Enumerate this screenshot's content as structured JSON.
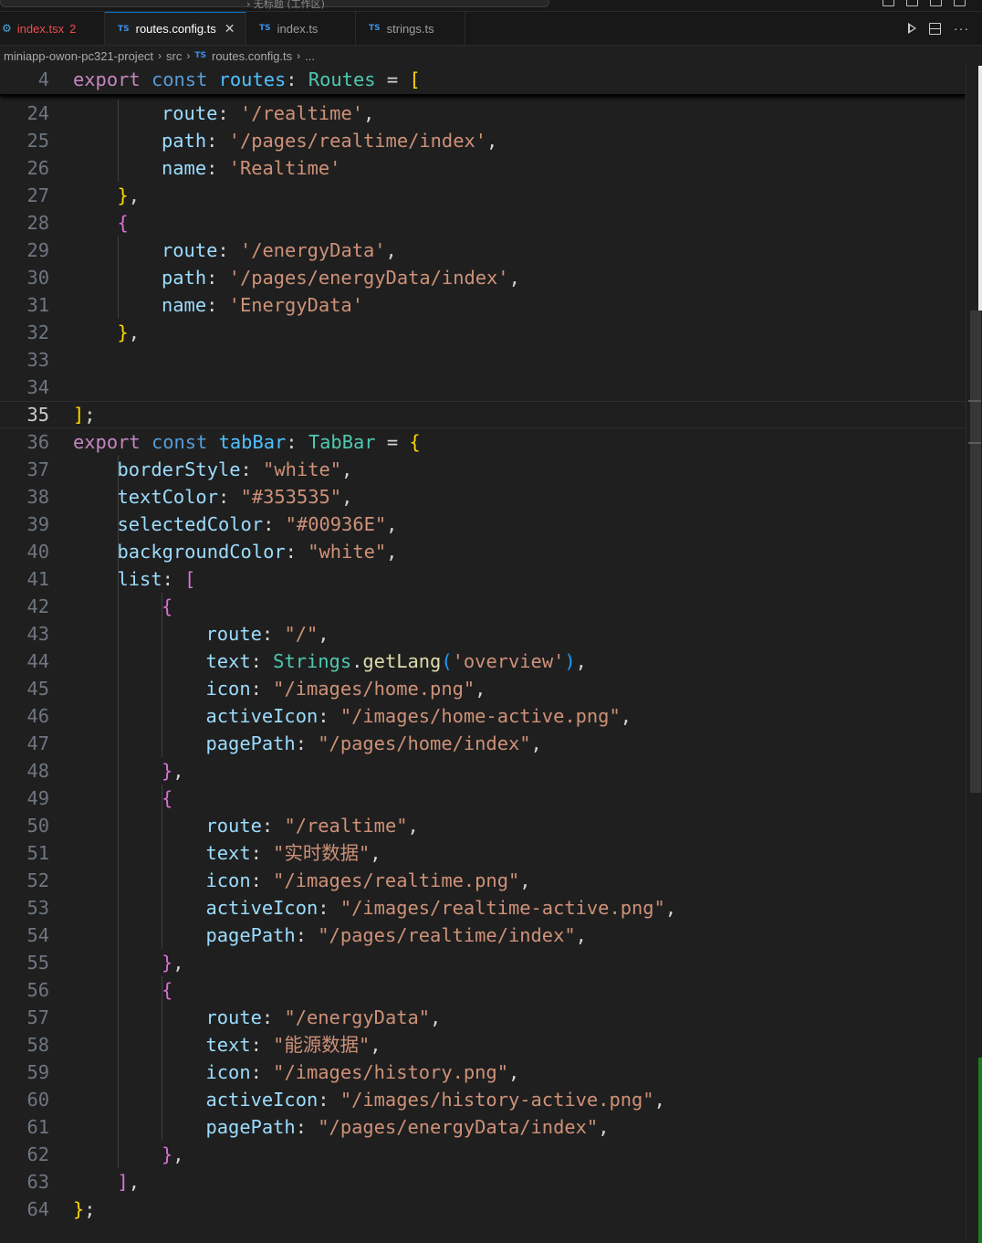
{
  "titlebar": {
    "text": "› 无标题 (工作区)"
  },
  "tabs": [
    {
      "label": "index.tsx",
      "badge": "2",
      "kind": "react"
    },
    {
      "label": "routes.config.ts",
      "kind": "ts",
      "active": true
    },
    {
      "label": "index.ts",
      "kind": "ts"
    },
    {
      "label": "strings.ts",
      "kind": "ts"
    }
  ],
  "breadcrumb": [
    "miniapp-owon-pc321-project",
    "src",
    "routes.config.ts",
    "..."
  ],
  "editor": {
    "current_line": 35,
    "sticky_line": {
      "number": "4",
      "text": "export const routes: Routes = ["
    },
    "lines": [
      {
        "n": "24",
        "text": "route: '/realtime',",
        "indent": 2
      },
      {
        "n": "25",
        "text": "path: '/pages/realtime/index',",
        "indent": 2
      },
      {
        "n": "26",
        "text": "name: 'Realtime'",
        "indent": 2
      },
      {
        "n": "27",
        "text": "},",
        "indent": 1
      },
      {
        "n": "28",
        "text": "{",
        "indent": 1
      },
      {
        "n": "29",
        "text": "route: '/energyData',",
        "indent": 2
      },
      {
        "n": "30",
        "text": "path: '/pages/energyData/index',",
        "indent": 2
      },
      {
        "n": "31",
        "text": "name: 'EnergyData'",
        "indent": 2
      },
      {
        "n": "32",
        "text": "},",
        "indent": 1
      },
      {
        "n": "33",
        "text": "",
        "indent": 0
      },
      {
        "n": "34",
        "text": "",
        "indent": 0
      },
      {
        "n": "35",
        "text": "];",
        "indent": 0
      },
      {
        "n": "36",
        "text": "export const tabBar: TabBar = {",
        "indent": 0
      },
      {
        "n": "37",
        "text": "borderStyle: \"white\",",
        "indent": 1
      },
      {
        "n": "38",
        "text": "textColor: \"#353535\",",
        "indent": 1
      },
      {
        "n": "39",
        "text": "selectedColor: \"#00936E\",",
        "indent": 1
      },
      {
        "n": "40",
        "text": "backgroundColor: \"white\",",
        "indent": 1
      },
      {
        "n": "41",
        "text": "list: [",
        "indent": 1
      },
      {
        "n": "42",
        "text": "{",
        "indent": 2
      },
      {
        "n": "43",
        "text": "route: \"/\",",
        "indent": 3
      },
      {
        "n": "44",
        "text": "text: Strings.getLang('overview'),",
        "indent": 3
      },
      {
        "n": "45",
        "text": "icon: \"/images/home.png\",",
        "indent": 3
      },
      {
        "n": "46",
        "text": "activeIcon: \"/images/home-active.png\",",
        "indent": 3
      },
      {
        "n": "47",
        "text": "pagePath: \"/pages/home/index\",",
        "indent": 3
      },
      {
        "n": "48",
        "text": "},",
        "indent": 2
      },
      {
        "n": "49",
        "text": "{",
        "indent": 2
      },
      {
        "n": "50",
        "text": "route: \"/realtime\",",
        "indent": 3
      },
      {
        "n": "51",
        "text": "text: \"实时数据\",",
        "indent": 3
      },
      {
        "n": "52",
        "text": "icon: \"/images/realtime.png\",",
        "indent": 3
      },
      {
        "n": "53",
        "text": "activeIcon: \"/images/realtime-active.png\",",
        "indent": 3
      },
      {
        "n": "54",
        "text": "pagePath: \"/pages/realtime/index\",",
        "indent": 3
      },
      {
        "n": "55",
        "text": "},",
        "indent": 2
      },
      {
        "n": "56",
        "text": "{",
        "indent": 2
      },
      {
        "n": "57",
        "text": "route: \"/energyData\",",
        "indent": 3
      },
      {
        "n": "58",
        "text": "text: \"能源数据\",",
        "indent": 3
      },
      {
        "n": "59",
        "text": "icon: \"/images/history.png\",",
        "indent": 3
      },
      {
        "n": "60",
        "text": "activeIcon: \"/images/history-active.png\",",
        "indent": 3
      },
      {
        "n": "61",
        "text": "pagePath: \"/pages/energyData/index\",",
        "indent": 3
      },
      {
        "n": "62",
        "text": "},",
        "indent": 2
      },
      {
        "n": "63",
        "text": "],",
        "indent": 1
      },
      {
        "n": "64",
        "text": "};",
        "indent": 0
      }
    ]
  },
  "colors": {
    "background": "#1f1f1f",
    "keyword": "#c586c0",
    "storage": "#569cd6",
    "variable": "#4fc1ff",
    "type": "#4ec9b0",
    "property": "#9cdcfe",
    "string": "#ce9178",
    "function": "#dcdcaa",
    "bracket1": "#ffd700",
    "bracket2": "#da70d6",
    "bracket3": "#179fff",
    "accent": "#0078d4"
  }
}
